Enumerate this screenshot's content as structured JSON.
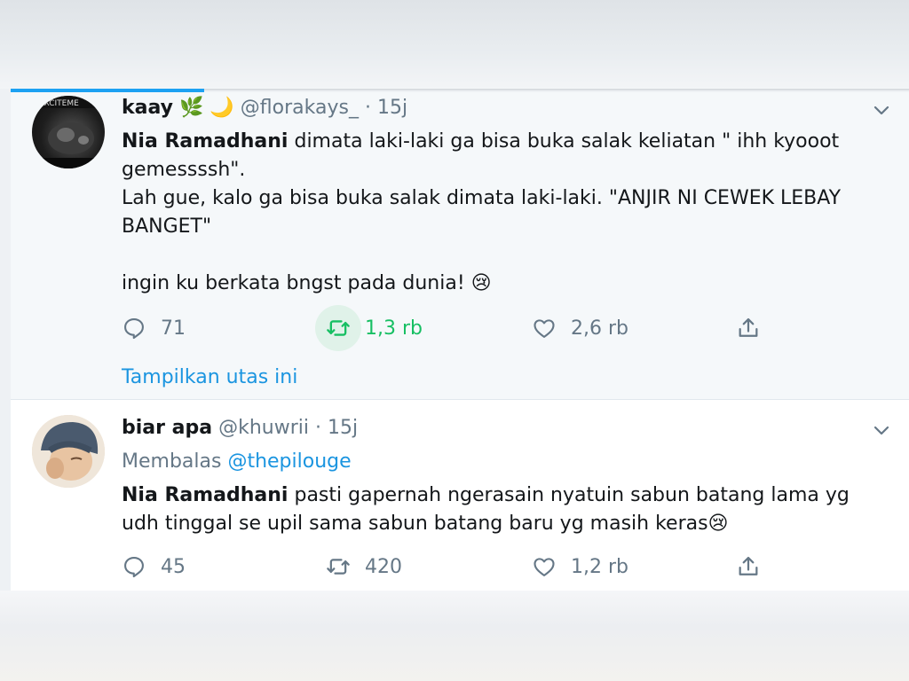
{
  "tweets": [
    {
      "author_name": "kaay",
      "author_emoji": "🌿 🌙",
      "handle": "@florakays_",
      "separator": "·",
      "time": "15j",
      "avatar_text": "EXCITEME",
      "text_mention": "Nia Ramadhani",
      "text_line1": " dimata laki-laki ga bisa buka salak keliatan \" ihh kyooot",
      "text_line2": "gemessssh\".",
      "text_line3": "Lah gue, kalo ga bisa buka salak dimata laki-laki. \"ANJIR NI CEWEK LEBAY",
      "text_line4": "BANGET\"",
      "text_line6": "ingin ku berkata bngst pada dunia! 😢",
      "replies": "71",
      "retweets": "1,3 rb",
      "likes": "2,6 rb",
      "show_thread": "Tampilkan utas ini"
    },
    {
      "author_name": "biar apa",
      "handle": "@khuwrii",
      "separator": "·",
      "time": "15j",
      "reply_prefix": "Membalas",
      "reply_to": "@thepilouge",
      "text_mention": "Nia Ramadhani",
      "text_line1": " pasti gapernah ngerasain nyatuin sabun batang lama yg",
      "text_line2": "udh tinggal se upil sama sabun batang baru yg masih keras😢",
      "replies": "45",
      "retweets": "420",
      "likes": "1,2 rb"
    }
  ],
  "colors": {
    "accent": "#1b95e0",
    "retweet_active": "#17bf63",
    "muted": "#657786",
    "text": "#14171a"
  },
  "icons": [
    "reply-icon",
    "retweet-icon",
    "like-icon",
    "share-icon",
    "chevron-down-icon"
  ]
}
